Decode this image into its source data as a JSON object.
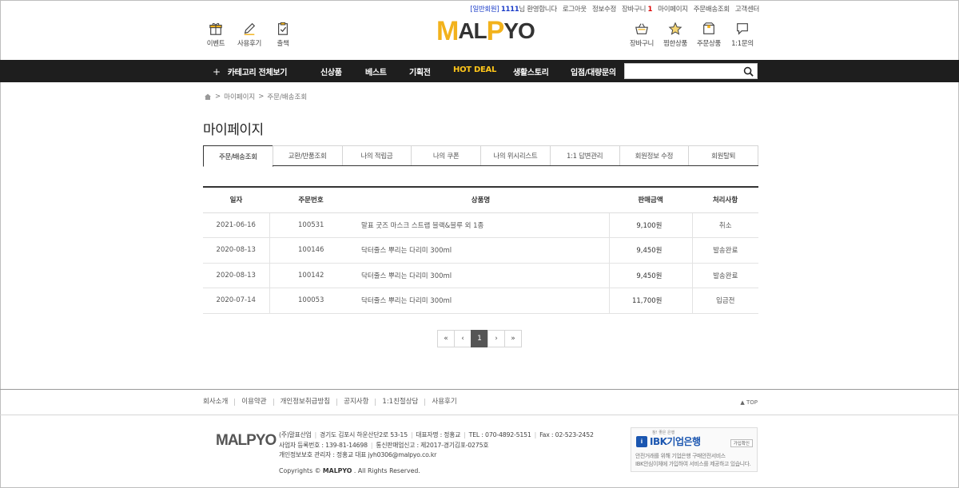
{
  "utility_bar": {
    "grade": "[일반회원]",
    "user_id": "1111",
    "greeting": "님 환영합니다",
    "links": [
      "로그아웃",
      "정보수정",
      "장바구니",
      "마이페이지",
      "주문배송조회",
      "고객센터"
    ],
    "cart_count": "1"
  },
  "header_left": [
    {
      "icon": "gift-icon",
      "label": "이벤트"
    },
    {
      "icon": "pencil-icon",
      "label": "사용후기"
    },
    {
      "icon": "check-clipboard-icon",
      "label": "출책"
    }
  ],
  "header_right": [
    {
      "icon": "basket-icon",
      "label": "장바구니"
    },
    {
      "icon": "star-icon",
      "label": "찜한상품"
    },
    {
      "icon": "box-icon",
      "label": "주문상품"
    },
    {
      "icon": "chat-icon",
      "label": "1:1문의"
    }
  ],
  "logo": {
    "text": "MALPYO"
  },
  "nav": {
    "category_label": "카테고리 전체보기",
    "items": [
      "신상품",
      "베스트",
      "기획전",
      "HOT DEAL",
      "생활스토리",
      "입점/대량문의"
    ],
    "search_placeholder": ""
  },
  "breadcrumb": [
    "마이페이지",
    "주문/배송조회"
  ],
  "page_title": "마이페이지",
  "tabs": [
    "주문/배송조회",
    "교환/반품조회",
    "나의 적립금",
    "나의 쿠폰",
    "나의 위시리스트",
    "1:1 답변관리",
    "회원정보 수정",
    "회원탈퇴"
  ],
  "active_tab": "주문/배송조회",
  "order_table": {
    "headers": [
      "일자",
      "주문번호",
      "상품명",
      "판매금액",
      "처리사항"
    ],
    "rows": [
      [
        "2021-06-16",
        "100531",
        "말표 굿즈 마스크 스트랩 블랙&블루 외 1종",
        "9,100원",
        "취소"
      ],
      [
        "2020-08-13",
        "100146",
        "닥터줄스 뿌리는 다리미 300ml",
        "9,450원",
        "발송완료"
      ],
      [
        "2020-08-13",
        "100142",
        "닥터줄스 뿌리는 다리미 300ml",
        "9,450원",
        "발송완료"
      ],
      [
        "2020-07-14",
        "100053",
        "닥터줄스 뿌리는 다리미 300ml",
        "11,700원",
        "입금전"
      ]
    ]
  },
  "pagination": {
    "first": "«",
    "prev": "‹",
    "current": "1",
    "next": "›",
    "last": "»"
  },
  "footer": {
    "links": [
      "회사소개",
      "이용약관",
      "개인정보취급방침",
      "공지사항",
      "1:1친절상담",
      "사용후기"
    ],
    "top_label": "TOP",
    "logo": "MALPYO",
    "info_line1": [
      "(주)말표산업",
      "경기도 김포시 하운산단2로 53-15",
      "대표자명 : 정홍교",
      "TEL : 070-4892-5151",
      "Fax : 02-523-2452"
    ],
    "info_line2": [
      "사업자 등록번호 : 139-81-14698",
      "통신판매업신고 : 제2017-경기김포-0275호"
    ],
    "info_line3": "개인정보보호 관리자 : 정홍교 대표 jyh0306@malpyo.co.kr",
    "copyright_prefix": "Copyrights ©",
    "copyright_brand": "MALPYO",
    "copyright_suffix": ". All Rights Reserved."
  },
  "ibk": {
    "tagline": "참! 좋은 은행",
    "name": "IBK기업은행",
    "button": "가입확인",
    "desc1": "안전거래를 위해 기업은행 구매안전서비스",
    "desc2": "IBK안심이체에 가입하여 서비스를 제공하고 있습니다."
  },
  "colors": {
    "nav_bg": "#1e1e1e",
    "hot_deal": "#ffc61a",
    "logo_yellow": "#f2b21c",
    "grade_blue": "#1a3cc8",
    "ibk_blue": "#1b56b0"
  }
}
